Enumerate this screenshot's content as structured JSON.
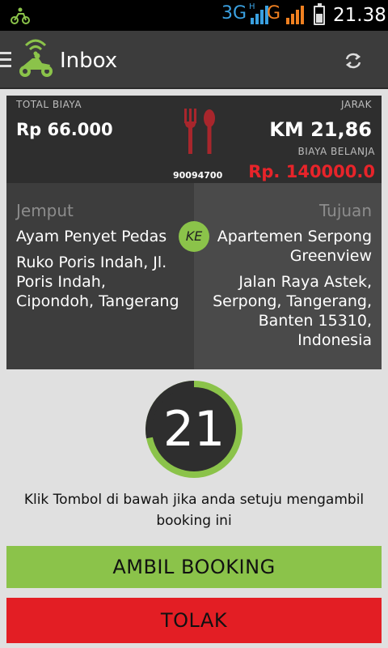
{
  "status_bar": {
    "network_label": "3G",
    "hplus_label": "H",
    "network2_label": "G",
    "time": "21.38"
  },
  "header": {
    "title": "Inbox",
    "icons": [
      "menu-icon",
      "gojek-driver-icon",
      "refresh-icon"
    ]
  },
  "summary": {
    "total_label": "TOTAL BIAYA",
    "total_value": "Rp 66.000",
    "distance_label": "JARAK",
    "distance_value": "KM 21,86",
    "shopping_label": "BIAYA BELANJA",
    "shopping_value": "Rp. 140000.0",
    "order_id": "90094700",
    "service_icon": "cutlery-icon"
  },
  "route": {
    "pickup_header": "Jemput",
    "pickup_name": "Ayam Penyet Pedas",
    "pickup_address": "Ruko Poris Indah, Jl. Poris Indah, Cipondoh, Tangerang",
    "ke_label": "KE",
    "dest_header": "Tujuan",
    "dest_name": "Apartemen Serpong Greenview",
    "dest_address": "Jalan Raya Astek, Serpong, Tangerang, Banten 15310, Indonesia"
  },
  "countdown": {
    "value": "21",
    "progress": 0.72
  },
  "instruction": "Klik Tombol di bawah jika anda setuju mengambil booking ini",
  "actions": {
    "accept_label": "AMBIL BOOKING",
    "reject_label": "TOLAK"
  },
  "colors": {
    "accent_green": "#8bc34a",
    "reject_red": "#e31e24",
    "price_red": "#e8242a"
  }
}
